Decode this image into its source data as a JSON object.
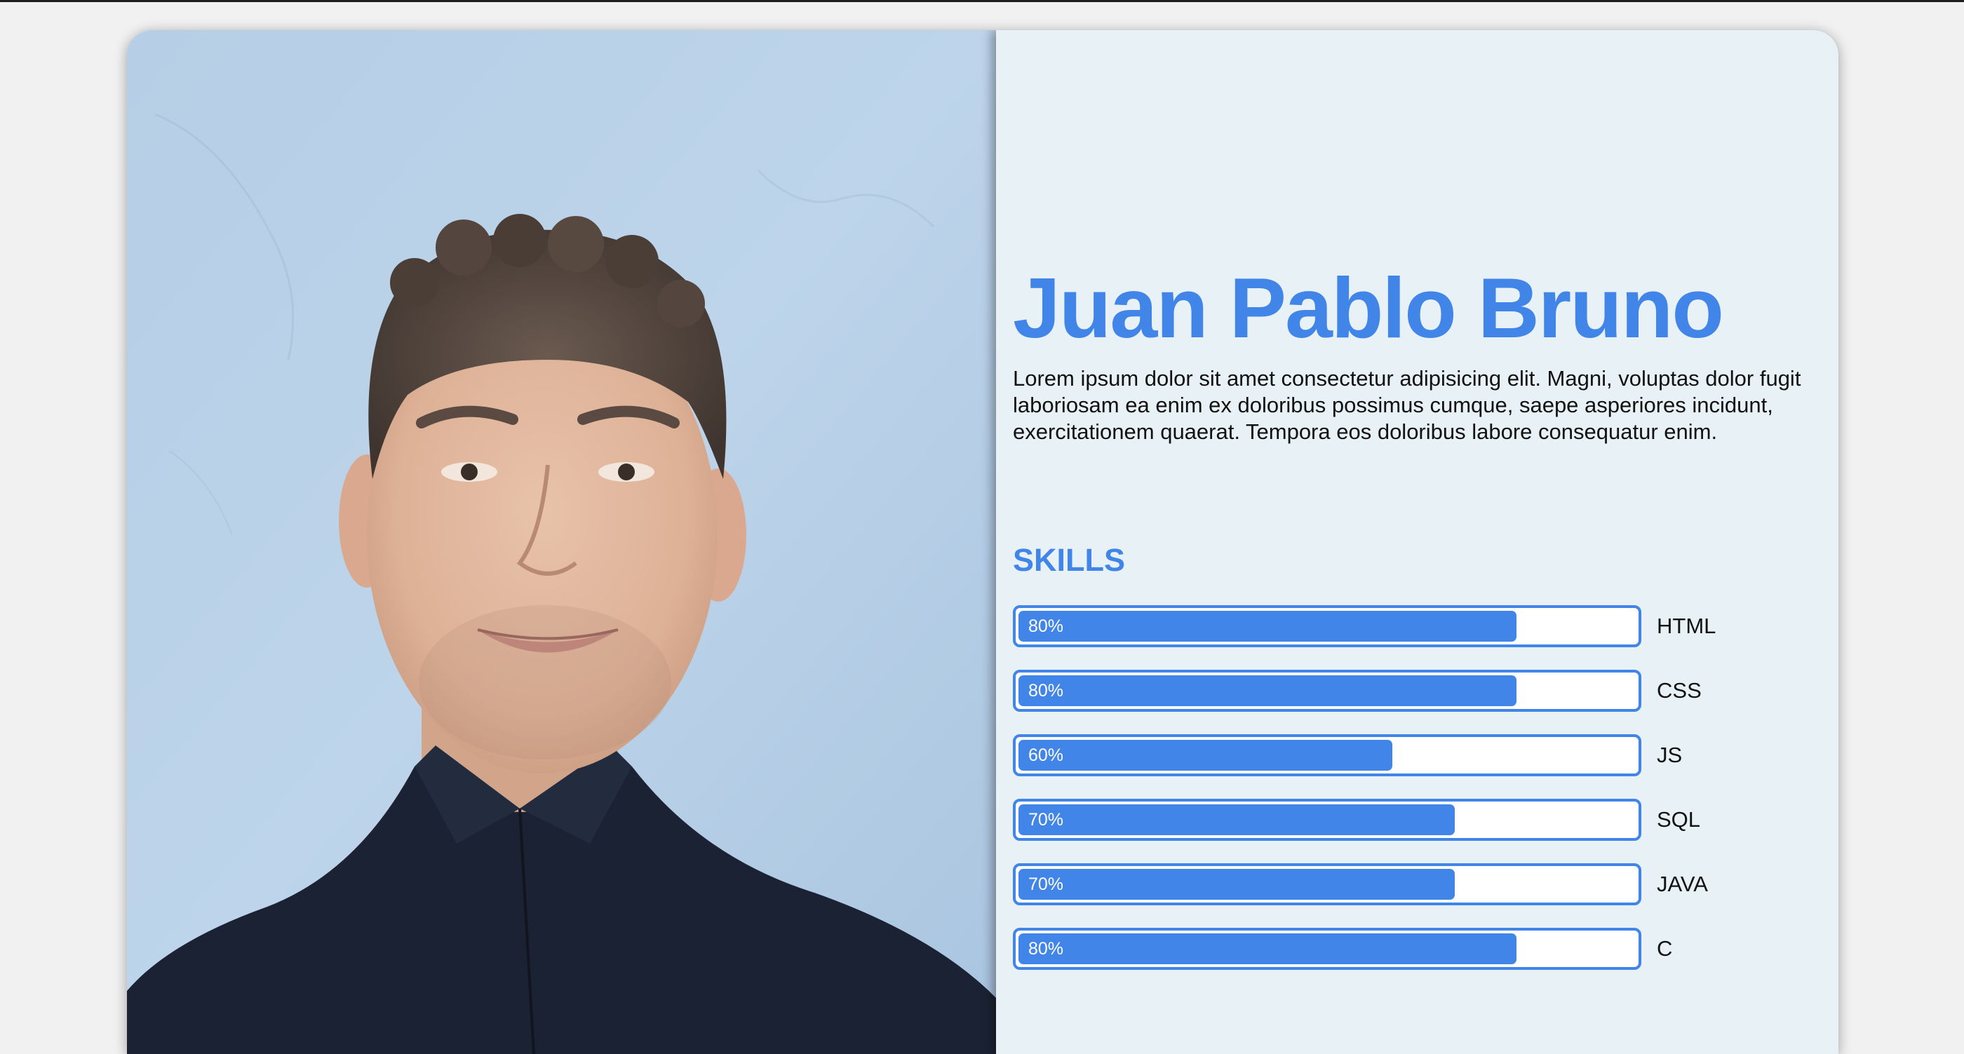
{
  "profile": {
    "name": "Juan Pablo Bruno",
    "bio": "Lorem ipsum dolor sit amet consectetur adipisicing elit. Magni, voluptas dolor fugit laboriosam ea enim ex doloribus possimus cumque, saepe asperiores incidunt, exercitationem quaerat. Tempora eos doloribus labore consequatur enim.",
    "photo_icon": "portrait-photo"
  },
  "skills": {
    "title": "SKILLS",
    "items": [
      {
        "name": "HTML",
        "percent_label": "80%",
        "level": 0.8
      },
      {
        "name": "CSS",
        "percent_label": "80%",
        "level": 0.8
      },
      {
        "name": "JS",
        "percent_label": "60%",
        "level": 0.6
      },
      {
        "name": "SQL",
        "percent_label": "70%",
        "level": 0.7
      },
      {
        "name": "JAVA",
        "percent_label": "70%",
        "level": 0.7
      },
      {
        "name": "C",
        "percent_label": "80%",
        "level": 0.8
      }
    ]
  },
  "colors": {
    "accent": "#4285e8",
    "panel_bg": "#e8f1f5",
    "page_bg": "#f1f1f1",
    "photo_bg": "#b9d0e6"
  }
}
